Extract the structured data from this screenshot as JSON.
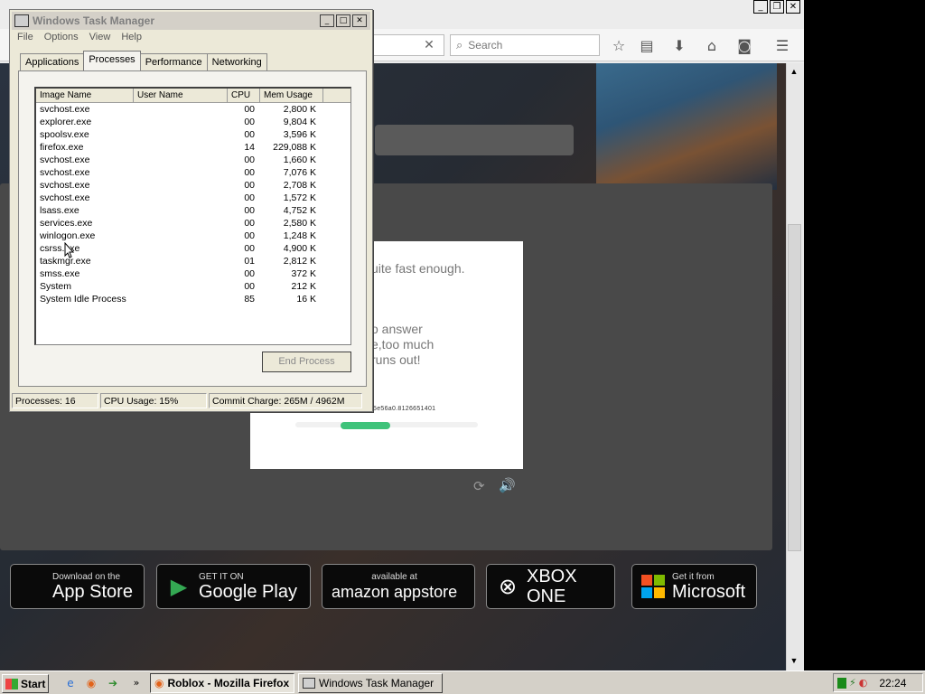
{
  "firefox": {
    "search_placeholder": "Search",
    "taskbar_title": "Roblox - Mozilla Firefox"
  },
  "captcha": {
    "line1": "uite fast enough.",
    "line2a": "o answer",
    "line2b": "e,too much",
    "line2c": "runs out!",
    "session_id": "5e56a0.8126651401",
    "progress": 0.27
  },
  "stores": [
    {
      "small": "Download on the",
      "big": "App Store",
      "icon": "apple-icon"
    },
    {
      "small": "GET IT ON",
      "big": "Google Play",
      "icon": "play-icon"
    },
    {
      "small": "available at",
      "big": "amazon appstore",
      "icon": "amazon-icon"
    },
    {
      "small": "",
      "big": "XBOX ONE",
      "icon": "xbox-icon"
    },
    {
      "small": "Get it from",
      "big": "Microsoft",
      "icon": "microsoft-icon"
    }
  ],
  "task_manager": {
    "title": "Windows Task Manager",
    "menu": [
      "File",
      "Options",
      "View",
      "Help"
    ],
    "tabs": [
      "Applications",
      "Processes",
      "Performance",
      "Networking"
    ],
    "active_tab": "Processes",
    "columns": [
      "Image Name",
      "User Name",
      "CPU",
      "Mem Usage"
    ],
    "processes": [
      {
        "name": "svchost.exe",
        "user": "",
        "cpu": "00",
        "mem": "2,800 K"
      },
      {
        "name": "explorer.exe",
        "user": "",
        "cpu": "00",
        "mem": "9,804 K"
      },
      {
        "name": "spoolsv.exe",
        "user": "",
        "cpu": "00",
        "mem": "3,596 K"
      },
      {
        "name": "firefox.exe",
        "user": "",
        "cpu": "14",
        "mem": "229,088 K"
      },
      {
        "name": "svchost.exe",
        "user": "",
        "cpu": "00",
        "mem": "1,660 K"
      },
      {
        "name": "svchost.exe",
        "user": "",
        "cpu": "00",
        "mem": "7,076 K"
      },
      {
        "name": "svchost.exe",
        "user": "",
        "cpu": "00",
        "mem": "2,708 K"
      },
      {
        "name": "svchost.exe",
        "user": "",
        "cpu": "00",
        "mem": "1,572 K"
      },
      {
        "name": "lsass.exe",
        "user": "",
        "cpu": "00",
        "mem": "4,752 K"
      },
      {
        "name": "services.exe",
        "user": "",
        "cpu": "00",
        "mem": "2,580 K"
      },
      {
        "name": "winlogon.exe",
        "user": "",
        "cpu": "00",
        "mem": "1,248 K"
      },
      {
        "name": "csrss.exe",
        "user": "",
        "cpu": "00",
        "mem": "4,900 K"
      },
      {
        "name": "taskmgr.exe",
        "user": "",
        "cpu": "01",
        "mem": "2,812 K"
      },
      {
        "name": "smss.exe",
        "user": "",
        "cpu": "00",
        "mem": "372 K"
      },
      {
        "name": "System",
        "user": "",
        "cpu": "00",
        "mem": "212 K"
      },
      {
        "name": "System Idle Process",
        "user": "",
        "cpu": "85",
        "mem": "16 K"
      }
    ],
    "end_process_label": "End Process",
    "status": {
      "processes": "Processes: 16",
      "cpu": "CPU Usage: 15%",
      "commit": "Commit Charge: 265M / 4962M"
    }
  },
  "taskbar": {
    "start_label": "Start",
    "tasks": [
      "Roblox - Mozilla Firefox",
      "Windows Task Manager"
    ],
    "clock": "22:24"
  }
}
